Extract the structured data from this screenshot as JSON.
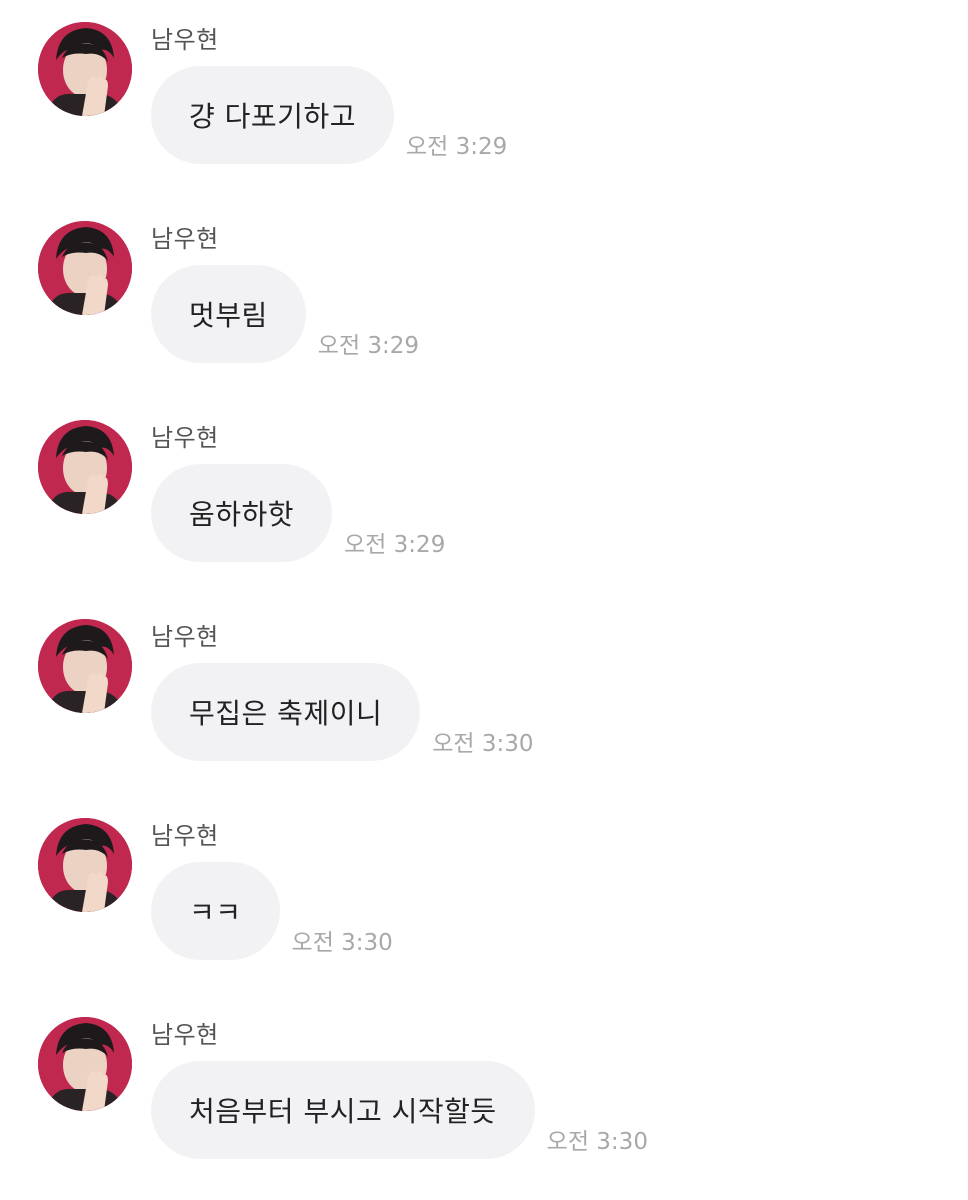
{
  "messages": [
    {
      "sender": "남우현",
      "text": "걍 다포기하고",
      "time": "오전 3:29"
    },
    {
      "sender": "남우현",
      "text": "멋부림",
      "time": "오전 3:29"
    },
    {
      "sender": "남우현",
      "text": "움하하핫",
      "time": "오전 3:29"
    },
    {
      "sender": "남우현",
      "text": "무집은 축제이니",
      "time": "오전 3:30"
    },
    {
      "sender": "남우현",
      "text": "ㅋㅋ",
      "time": "오전 3:30"
    },
    {
      "sender": "남우현",
      "text": "처음부터 부시고 시작할듯",
      "time": "오전 3:30"
    }
  ],
  "colors": {
    "bubble": "#f2f2f5",
    "avatar_background": "#c0284f",
    "timestamp": "#a8a8a8"
  },
  "icons": {
    "avatar": "profile-photo"
  }
}
